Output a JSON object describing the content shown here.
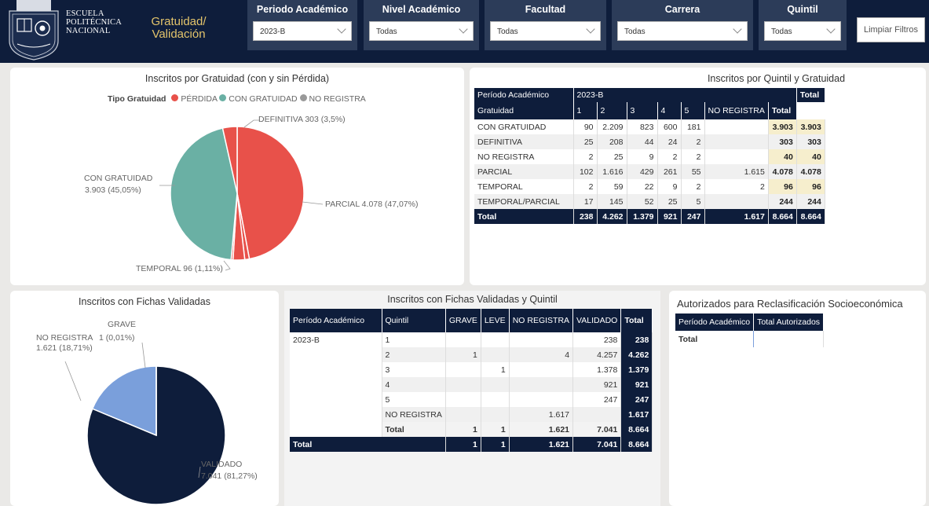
{
  "header": {
    "logo_text": [
      "ESCUELA",
      "POLITÉCNICA",
      "NACIONAL"
    ],
    "app_title_line1": "Gratuidad/",
    "app_title_line2": "Validación",
    "filters": [
      {
        "label": "Periodo Académico",
        "value": "2023-B"
      },
      {
        "label": "Nivel Académico",
        "value": "Todas"
      },
      {
        "label": "Facultad",
        "value": "Todas"
      },
      {
        "label": "Carrera",
        "value": "Todas"
      },
      {
        "label": "Quintil",
        "value": "Todas"
      }
    ],
    "clear_button": "Limpiar Filtros"
  },
  "pie1": {
    "title": "Inscritos por Gratuidad (con y sin Pérdida)",
    "legend_title": "Tipo Gratuidad",
    "legend": [
      {
        "label": "PÉRDIDA",
        "color": "#e8514a"
      },
      {
        "label": "CON GRATUIDAD",
        "color": "#6ab0a4"
      },
      {
        "label": "NO REGISTRA",
        "color": "#999999"
      }
    ],
    "labels": {
      "definitiva": "DEFINITIVA 303 (3,5%)",
      "con_gratuidad_1": "CON GRATUIDAD",
      "con_gratuidad_2": "3.903 (45,05%)",
      "parcial": "PARCIAL 4.078 (47,07%)",
      "temporal": "TEMPORAL 96 (1,11%)"
    }
  },
  "chart_data": [
    {
      "type": "pie",
      "title": "Inscritos por Gratuidad (con y sin Pérdida)",
      "legend_title": "Tipo Gratuidad",
      "slices": [
        {
          "label": "PARCIAL",
          "value": 4078,
          "percent": 47.07,
          "color": "#e8514a"
        },
        {
          "label": "TEMPORAL",
          "value": 96,
          "percent": 1.11,
          "color": "#e8514a"
        },
        {
          "label": "TEMPORAL/PARCIAL",
          "value": 244,
          "color": "#e8514a"
        },
        {
          "label": "NO REGISTRA",
          "value": 40,
          "color": "#e8514a"
        },
        {
          "label": "CON GRATUIDAD",
          "value": 3903,
          "percent": 45.05,
          "color": "#6ab0a4"
        },
        {
          "label": "DEFINITIVA",
          "value": 303,
          "percent": 3.5,
          "color": "#e8514a"
        }
      ]
    },
    {
      "type": "pie",
      "title": "Inscritos con Fichas Validadas",
      "slices": [
        {
          "label": "VALIDADO",
          "value": 7041,
          "percent": 81.27,
          "color": "#0e1d3b"
        },
        {
          "label": "NO REGISTRA",
          "value": 1621,
          "percent": 18.71,
          "color": "#7a9fdb"
        },
        {
          "label": "GRAVE",
          "value": 1,
          "percent": 0.01,
          "color": "#0e1d3b"
        }
      ]
    }
  ],
  "quintil_table": {
    "title": "Inscritos por Quintil y Gratuidad",
    "header1": [
      "Período Académico",
      "2023-B",
      "Total"
    ],
    "header2": [
      "Gratuidad",
      "1",
      "2",
      "3",
      "4",
      "5",
      "NO REGISTRA",
      "Total"
    ],
    "rows": [
      {
        "label": "CON GRATUIDAD",
        "v1": "90",
        "v2": "2.209",
        "v3": "823",
        "v4": "600",
        "v5": "181",
        "nr": "",
        "total": "3.903",
        "grand": "3.903"
      },
      {
        "label": "DEFINITIVA",
        "v1": "25",
        "v2": "208",
        "v3": "44",
        "v4": "24",
        "v5": "2",
        "nr": "",
        "total": "303",
        "grand": "303"
      },
      {
        "label": "NO REGISTRA",
        "v1": "2",
        "v2": "25",
        "v3": "9",
        "v4": "2",
        "v5": "2",
        "nr": "",
        "total": "40",
        "grand": "40"
      },
      {
        "label": "PARCIAL",
        "v1": "102",
        "v2": "1.616",
        "v3": "429",
        "v4": "261",
        "v5": "55",
        "nr": "1.615",
        "total": "4.078",
        "grand": "4.078"
      },
      {
        "label": "TEMPORAL",
        "v1": "2",
        "v2": "59",
        "v3": "22",
        "v4": "9",
        "v5": "2",
        "nr": "2",
        "total": "96",
        "grand": "96"
      },
      {
        "label": "TEMPORAL/PARCIAL",
        "v1": "17",
        "v2": "145",
        "v3": "52",
        "v4": "25",
        "v5": "5",
        "nr": "",
        "total": "244",
        "grand": "244"
      }
    ],
    "total_row": {
      "label": "Total",
      "v1": "238",
      "v2": "4.262",
      "v3": "1.379",
      "v4": "921",
      "v5": "247",
      "nr": "1.617",
      "total": "8.664",
      "grand": "8.664"
    }
  },
  "pie2": {
    "title": "Inscritos con Fichas Validadas",
    "labels": {
      "grave_1": "GRAVE",
      "grave_2": "1 (0,01%)",
      "noreg_1": "NO REGISTRA",
      "noreg_2": "1.621 (18,71%)",
      "validado_1": "VALIDADO",
      "validado_2": "7.041 (81,27%)"
    }
  },
  "fichas_table": {
    "title": "Inscritos con Fichas Validadas y Quintil",
    "headers": [
      "Período Académico",
      "Quintil",
      "GRAVE",
      "LEVE",
      "NO REGISTRA",
      "VALIDADO",
      "Total"
    ],
    "period": "2023-B",
    "rows": [
      {
        "quintil": "1",
        "grave": "",
        "leve": "",
        "noreg": "",
        "validado": "238",
        "total": "238"
      },
      {
        "quintil": "2",
        "grave": "1",
        "leve": "",
        "noreg": "4",
        "validado": "4.257",
        "total": "4.262"
      },
      {
        "quintil": "3",
        "grave": "",
        "leve": "1",
        "noreg": "",
        "validado": "1.378",
        "total": "1.379"
      },
      {
        "quintil": "4",
        "grave": "",
        "leve": "",
        "noreg": "",
        "validado": "921",
        "total": "921"
      },
      {
        "quintil": "5",
        "grave": "",
        "leve": "",
        "noreg": "",
        "validado": "247",
        "total": "247"
      },
      {
        "quintil": "NO REGISTRA",
        "grave": "",
        "leve": "",
        "noreg": "1.617",
        "validado": "",
        "total": "1.617"
      }
    ],
    "subtotal": {
      "quintil": "Total",
      "grave": "1",
      "leve": "1",
      "noreg": "1.621",
      "validado": "7.041",
      "total": "8.664"
    },
    "total": {
      "label": "Total",
      "grave": "1",
      "leve": "1",
      "noreg": "1.621",
      "validado": "7.041",
      "total": "8.664"
    }
  },
  "autorizados": {
    "title": "Autorizados para Reclasificación Socioeconómica",
    "headers": [
      "Período Académico",
      "Total Autorizados"
    ],
    "total_label": "Total"
  }
}
